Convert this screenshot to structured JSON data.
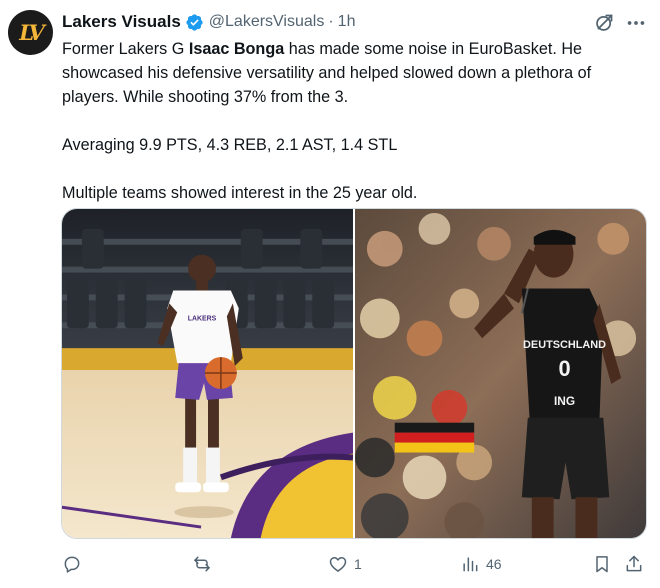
{
  "post": {
    "author": {
      "display_name": "Lakers Visuals",
      "handle": "@LakersVisuals",
      "verified": true,
      "avatar_text": "LV"
    },
    "separator": "·",
    "time": "1h",
    "text": {
      "line1_prefix": "Former Lakers G ",
      "line1_name": "Isaac Bonga",
      "line1_suffix": " has made some noise in EuroBasket. He showcased his defensive versatility and helped slowed down a plethora of players. While shooting 37% from the 3.",
      "line2": "Averaging 9.9 PTS, 4.3 REB, 2.1 AST, 1.4 STL",
      "line3": "Multiple teams showed interest in the 25 year old."
    },
    "media": {
      "left_photo": {
        "jersey_text": "LAKERS"
      },
      "right_photo": {
        "jersey_text": "DEUTSCHLAND",
        "jersey_number": "0",
        "sponsor_text": "ING"
      }
    },
    "actions": {
      "reply_count": "",
      "repost_count": "",
      "like_count": "1",
      "views_count": "46"
    }
  },
  "colors": {
    "verified": "#1d9bf0",
    "secondary_text": "#536471",
    "avatar_gold": "#f4b73a"
  },
  "icons": [
    "verified-badge-icon",
    "grok-icon",
    "more-icon",
    "reply-icon",
    "repost-icon",
    "like-icon",
    "views-icon",
    "bookmark-icon",
    "share-icon"
  ]
}
